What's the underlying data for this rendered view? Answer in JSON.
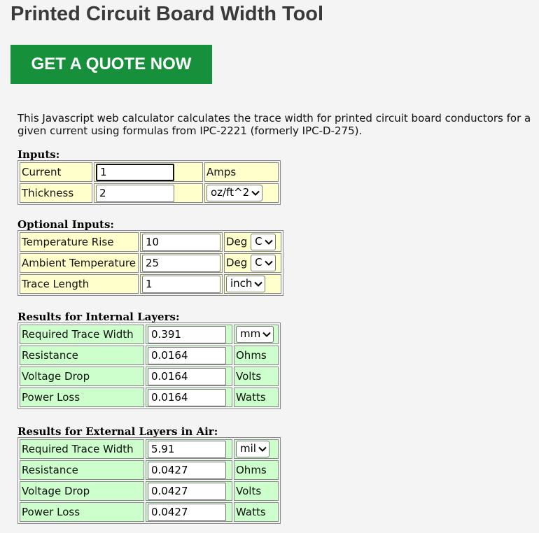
{
  "page": {
    "title": "Printed Circuit Board Width Tool",
    "cta_label": "GET A QUOTE NOW",
    "intro": "This Javascript web calculator calculates the trace width for printed circuit board conductors for a given current using formulas from IPC-2221 (formerly IPC-D-275)."
  },
  "inputs": {
    "heading": "Inputs:",
    "current": {
      "label": "Current",
      "value": "1",
      "unit": "Amps"
    },
    "thickness": {
      "label": "Thickness",
      "value": "2",
      "unit": "oz/ft^2"
    }
  },
  "optional": {
    "heading": "Optional Inputs:",
    "temp_rise": {
      "label": "Temperature Rise",
      "value": "10",
      "unit_prefix": "Deg",
      "unit": "C"
    },
    "ambient": {
      "label": "Ambient Temperature",
      "value": "25",
      "unit_prefix": "Deg",
      "unit": "C"
    },
    "length": {
      "label": "Trace Length",
      "value": "1",
      "unit": "inch"
    }
  },
  "internal": {
    "heading": "Results for Internal Layers:",
    "width": {
      "label": "Required Trace Width",
      "value": "0.391",
      "unit": "mm"
    },
    "resistance": {
      "label": "Resistance",
      "value": "0.0164",
      "unit": "Ohms"
    },
    "voltage": {
      "label": "Voltage Drop",
      "value": "0.0164",
      "unit": "Volts"
    },
    "power": {
      "label": "Power Loss",
      "value": "0.0164",
      "unit": "Watts"
    }
  },
  "external": {
    "heading": "Results for External Layers in Air:",
    "width": {
      "label": "Required Trace Width",
      "value": "5.91",
      "unit": "mil"
    },
    "resistance": {
      "label": "Resistance",
      "value": "0.0427",
      "unit": "Ohms"
    },
    "voltage": {
      "label": "Voltage Drop",
      "value": "0.0427",
      "unit": "Volts"
    },
    "power": {
      "label": "Power Loss",
      "value": "0.0427",
      "unit": "Watts"
    }
  },
  "colors": {
    "cta_background": "#17903c",
    "input_cell_background": "#ffffcc",
    "result_cell_background": "#ccffcc",
    "page_background": "#f4f4f4"
  },
  "icons": {
    "dropdown": "chevron-down-icon"
  }
}
